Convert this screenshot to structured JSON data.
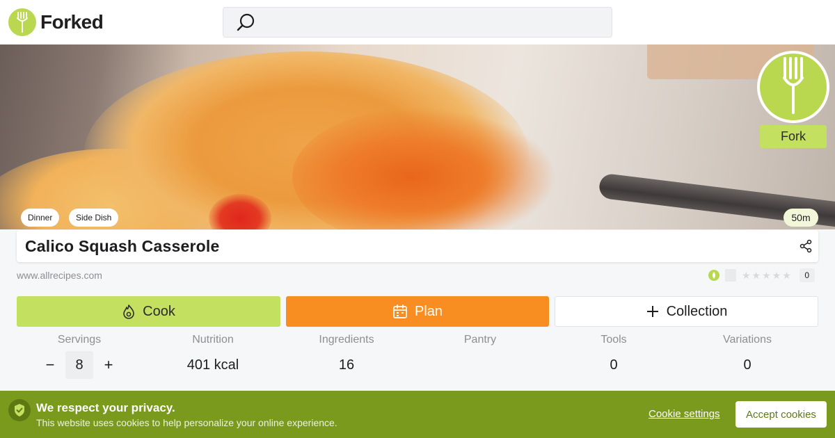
{
  "brand": {
    "name": "Forked",
    "accent": "#b9d84f",
    "icon": "fork-icon"
  },
  "search": {
    "placeholder": "",
    "icon": "search-icon"
  },
  "hero": {
    "tags": [
      "Dinner",
      "Side Dish"
    ],
    "time": "50m",
    "fork_label": "Fork"
  },
  "recipe": {
    "title": "Calico Squash Casserole",
    "source": "www.allrecipes.com",
    "rating_count": "0",
    "stars": 5
  },
  "actions": {
    "cook": {
      "label": "Cook",
      "color": "#c3e060",
      "icon": "flame-icon"
    },
    "plan": {
      "label": "Plan",
      "color": "#f88d21",
      "icon": "calendar-icon"
    },
    "collection": {
      "label": "Collection",
      "icon": "plus-icon"
    }
  },
  "stats": {
    "servings": {
      "label": "Servings",
      "value": "8",
      "minus": "−",
      "plus": "+"
    },
    "nutrition": {
      "label": "Nutrition",
      "value": "401 kcal"
    },
    "ingredients": {
      "label": "Ingredients",
      "value": "16"
    },
    "pantry": {
      "label": "Pantry",
      "value": ""
    },
    "tools": {
      "label": "Tools",
      "value": "0"
    },
    "variations": {
      "label": "Variations",
      "value": "0"
    }
  },
  "cookie_banner": {
    "title": "We respect your privacy.",
    "text": "This website uses cookies to help personalize your online experience.",
    "settings_label": "Cookie settings",
    "accept_label": "Accept cookies",
    "color": "#7a9a1e"
  }
}
